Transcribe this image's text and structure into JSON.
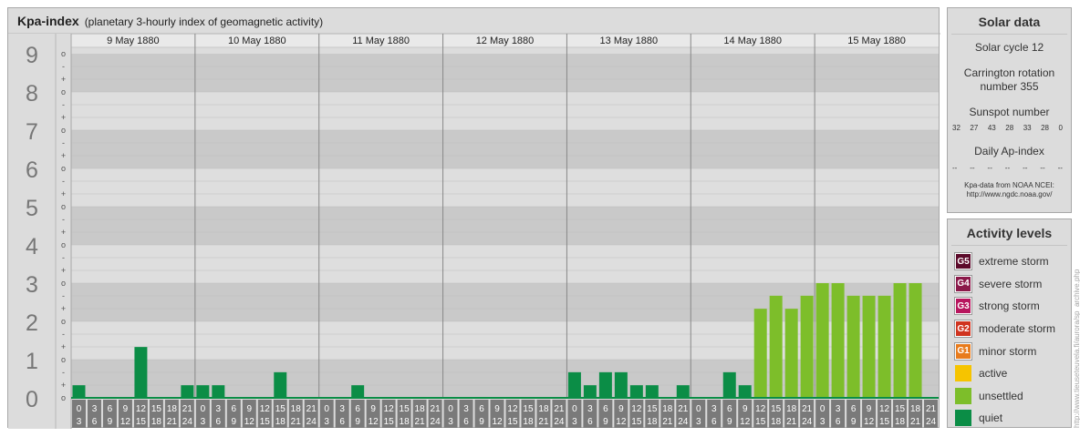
{
  "header": {
    "title": "Kpa-index",
    "subtitle": "(planetary 3-hourly index of geomagnetic activity)"
  },
  "chart_data": {
    "type": "bar",
    "title": "Kpa-index",
    "subtitle": "(planetary 3-hourly index of geomagnetic activity)",
    "ylim": [
      0,
      9
    ],
    "y_ticks": [
      "0",
      "1",
      "2",
      "3",
      "4",
      "5",
      "6",
      "7",
      "8",
      "9"
    ],
    "y_minor_ticks": [
      "o",
      "+",
      "-"
    ],
    "days": [
      "9 May 1880",
      "10 May 1880",
      "11 May 1880",
      "12 May 1880",
      "13 May 1880",
      "14 May 1880",
      "15 May 1880"
    ],
    "interval_labels_top": [
      "0",
      "3",
      "6",
      "9",
      "12",
      "15",
      "18",
      "21"
    ],
    "interval_labels_bottom": [
      "3",
      "6",
      "9",
      "12",
      "15",
      "18",
      "21",
      "24"
    ],
    "series": [
      {
        "name": "Kpa",
        "values": [
          0.33,
          0,
          0,
          0,
          1.33,
          0,
          0,
          0.33,
          0.33,
          0.33,
          0,
          0,
          0,
          0.67,
          0,
          0,
          0,
          0,
          0.33,
          0,
          0,
          0,
          0,
          0,
          0,
          0,
          0,
          0,
          0,
          0,
          0,
          0,
          0.67,
          0.33,
          0.67,
          0.67,
          0.33,
          0.33,
          0,
          0.33,
          0,
          0,
          0.67,
          0.33,
          2.33,
          2.67,
          2.33,
          2.67,
          3,
          3,
          2.67,
          2.67,
          2.67,
          3,
          3,
          0
        ]
      }
    ],
    "grid": true,
    "colors": {
      "quiet": "#0b8d46",
      "unsettled": "#7dbe2a",
      "active": "#f6c400",
      "band_dark": "#c9c9c9",
      "band_light": "#dedede",
      "label_bg": "#7a7a7a",
      "day_line": "#888888"
    }
  },
  "solar": {
    "heading": "Solar data",
    "cycle": "Solar cycle 12",
    "carrington_line1": "Carrington rotation",
    "carrington_line2": "number 355",
    "sunspot_label": "Sunspot number",
    "sunspot_values": [
      "32",
      "27",
      "43",
      "28",
      "33",
      "28",
      "0"
    ],
    "ap_label": "Daily Ap-index",
    "ap_values": [
      "--",
      "--",
      "--",
      "--",
      "--",
      "--",
      "--"
    ],
    "source_line1": "Kpa-data from NOAA NCEI:",
    "source_line2": "http://www.ngdc.noaa.gov/"
  },
  "activity": {
    "heading": "Activity levels",
    "levels": [
      {
        "badge": "G5",
        "label": "extreme storm",
        "color": "#5c0a2a"
      },
      {
        "badge": "G4",
        "label": "severe storm",
        "color": "#8b1a4a"
      },
      {
        "badge": "G3",
        "label": "strong storm",
        "color": "#b8165e"
      },
      {
        "badge": "G2",
        "label": "moderate storm",
        "color": "#d0341f"
      },
      {
        "badge": "G1",
        "label": "minor storm",
        "color": "#e87b1c"
      },
      {
        "badge": "",
        "label": "active",
        "color": "#f6c400"
      },
      {
        "badge": "",
        "label": "unsettled",
        "color": "#7dbe2a"
      },
      {
        "badge": "",
        "label": "quiet",
        "color": "#0b8d46"
      }
    ]
  },
  "watermark": "http://www.tieuseteuvela.fi/aurora/sp_archive.php"
}
